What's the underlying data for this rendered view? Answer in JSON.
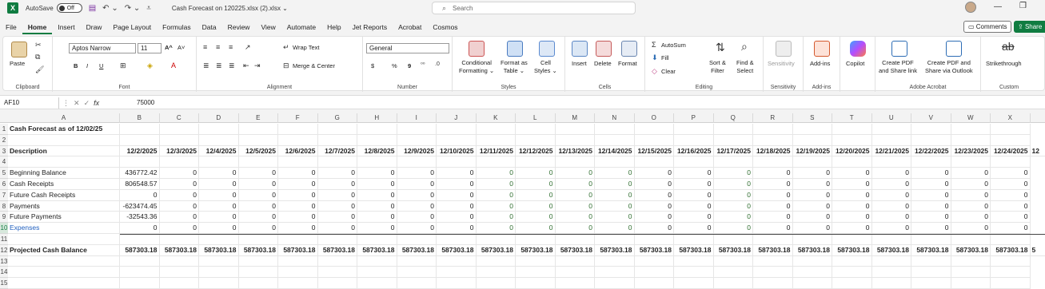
{
  "titlebar": {
    "autosave_label": "AutoSave",
    "autosave_state": "Off",
    "doc_title": "Cash Forecast on 120225.xlsx (2).xlsx ⌄",
    "search_placeholder": "Search"
  },
  "tabs": [
    "File",
    "Home",
    "Insert",
    "Draw",
    "Page Layout",
    "Formulas",
    "Data",
    "Review",
    "View",
    "Automate",
    "Help",
    "Jet Reports",
    "Acrobat",
    "Cosmos"
  ],
  "active_tab": "Home",
  "buttons": {
    "comments": "Comments",
    "share": "Share"
  },
  "ribbon": {
    "clipboard": {
      "label": "Clipboard",
      "paste": "Paste"
    },
    "font": {
      "label": "Font",
      "font_name": "Aptos Narrow",
      "font_size": "11",
      "bold": "B",
      "italic": "I",
      "underline": "U",
      "grow": "A^",
      "shrink": "A˅"
    },
    "alignment": {
      "label": "Alignment",
      "wrap_text": "Wrap Text",
      "merge_center": "Merge & Center"
    },
    "number": {
      "label": "Number",
      "format": "General",
      "currency": "$",
      "percent": "%",
      "comma": "9"
    },
    "styles": {
      "label": "Styles",
      "conditional": "Conditional\nFormatting ⌄",
      "format_table": "Format as\nTable ⌄",
      "cell_styles": "Cell\nStyles ⌄"
    },
    "cells": {
      "label": "Cells",
      "insert": "Insert",
      "delete": "Delete",
      "format": "Format"
    },
    "editing": {
      "label": "Editing",
      "autosum": "AutoSum",
      "fill": "Fill",
      "clear": "Clear",
      "sort_filter": "Sort &\nFilter",
      "find_select": "Find &\nSelect"
    },
    "sensitivity": {
      "label": "Sensitivity",
      "button": "Sensitivity"
    },
    "addins": {
      "label": "Add-ins",
      "button": "Add-ins"
    },
    "copilot": {
      "button": "Copilot"
    },
    "acrobat": {
      "label": "Adobe Acrobat",
      "create_pdf": "Create PDF\nand Share link",
      "create_pdf_outlook": "Create PDF and\nShare via Outlook"
    },
    "custom": {
      "label": "Custom",
      "strikethrough": "Strikethrough"
    }
  },
  "formula_bar": {
    "name_box": "AF10",
    "fx": "fx",
    "value": "75000"
  },
  "grid": {
    "columns": [
      "A",
      "B",
      "C",
      "D",
      "E",
      "F",
      "G",
      "H",
      "I",
      "J",
      "K",
      "L",
      "M",
      "N",
      "O",
      "P",
      "Q",
      "R",
      "S",
      "T",
      "U",
      "V",
      "W",
      "X"
    ],
    "rows": [
      "1",
      "2",
      "3",
      "4",
      "5",
      "6",
      "7",
      "8",
      "9",
      "10",
      "11",
      "12",
      "13",
      "14",
      "15"
    ],
    "title": "Cash Forecast as of 12/02/25",
    "description_header": "Description",
    "dates": [
      "12/2/2025",
      "12/3/2025",
      "12/4/2025",
      "12/5/2025",
      "12/6/2025",
      "12/7/2025",
      "12/8/2025",
      "12/9/2025",
      "12/10/2025",
      "12/11/2025",
      "12/12/2025",
      "12/13/2025",
      "12/14/2025",
      "12/15/2025",
      "12/16/2025",
      "12/17/2025",
      "12/18/2025",
      "12/19/2025",
      "12/20/2025",
      "12/21/2025",
      "12/22/2025",
      "12/23/2025",
      "12/24/2025",
      "12"
    ],
    "lines": [
      {
        "label": "Beginning Balance",
        "first": "436772.42"
      },
      {
        "label": "Cash Receipts",
        "first": "806548.57"
      },
      {
        "label": "Future Cash Receipts",
        "first": "0"
      },
      {
        "label": "Payments",
        "first": "-623474.45"
      },
      {
        "label": "Future Payments",
        "first": "-32543.36"
      },
      {
        "label": "Expenses",
        "first": "0"
      }
    ],
    "zero": "0",
    "projected_label": "Projected Cash Balance",
    "projected_value": "587303.18",
    "projected_last": "5"
  }
}
